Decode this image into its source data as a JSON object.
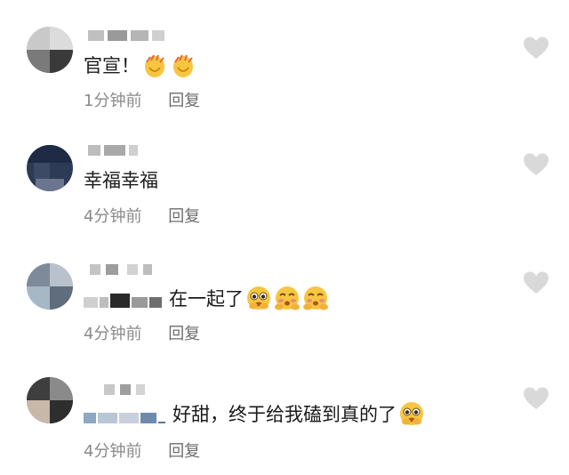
{
  "comments": [
    {
      "text": "官宣！",
      "emojis": [
        "clap-emoji",
        "clap-emoji"
      ],
      "time": "1分钟前",
      "reply": "回复"
    },
    {
      "text": "幸福幸福",
      "emojis": [],
      "time": "4分钟前",
      "reply": "回复"
    },
    {
      "text": "在一起了",
      "emojis": [
        "pleading-emoji",
        "blushing-emoji",
        "blushing-emoji"
      ],
      "time": "4分钟前",
      "reply": "回复"
    },
    {
      "text": "好甜，终于给我磕到真的了",
      "emojis": [
        "pleading-emoji"
      ],
      "time": "4分钟前",
      "reply": "回复"
    }
  ],
  "icons": {
    "like": "heart-icon"
  },
  "colors": {
    "like_heart": "#d9d9d9",
    "meta_text": "#8a8a8a",
    "body_text": "#1a1a1a"
  }
}
